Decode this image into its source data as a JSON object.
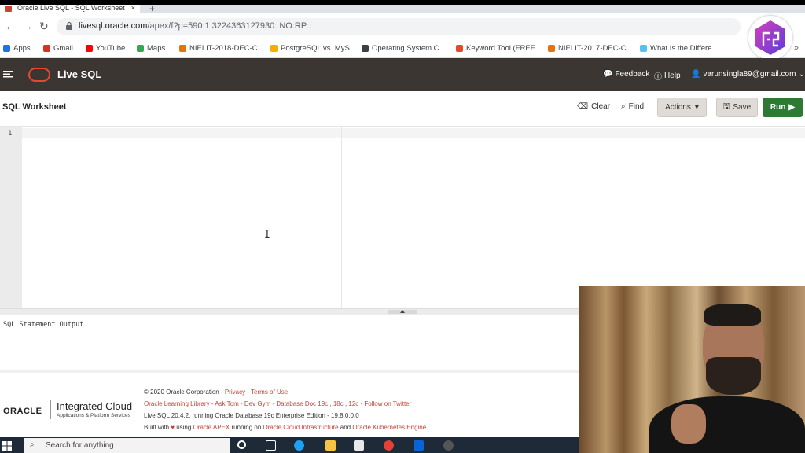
{
  "browser": {
    "tab_title": "Oracle Live SQL - SQL Worksheet",
    "tab_close": "×",
    "new_tab": "+",
    "url_host": "livesql.oracle.com",
    "url_path": "/apex/f?p=590:1:3224363127930::NO:RP::",
    "bookmarks": [
      {
        "label": "Apps",
        "color": "#1a73e8"
      },
      {
        "label": "Gmail",
        "color": "#d93025"
      },
      {
        "label": "YouTube",
        "color": "#ff0000"
      },
      {
        "label": "Maps",
        "color": "#34a853"
      },
      {
        "label": "NIELIT-2018-DEC-C...",
        "color": "#e8710a"
      },
      {
        "label": "PostgreSQL vs. MyS...",
        "color": "#f9ab00"
      },
      {
        "label": "Operating System C...",
        "color": "#3c4043"
      },
      {
        "label": "Keyword Tool (FREE...",
        "color": "#e8472f"
      },
      {
        "label": "NIELIT-2017-DEC-C...",
        "color": "#e8710a"
      },
      {
        "label": "What Is the Differe...",
        "color": "#4fc3f7"
      }
    ],
    "bookmarks_more": "»"
  },
  "app": {
    "name": "Live SQL",
    "feedback": "Feedback",
    "help": "Help",
    "user": "varunsingla89@gmail.com",
    "brand_color": "#e8472f"
  },
  "worksheet": {
    "title": "SQL Worksheet",
    "clear": "Clear",
    "find": "Find",
    "actions": "Actions",
    "save": "Save",
    "run": "Run",
    "line_number": "1",
    "cursor": "I"
  },
  "output": {
    "label": "SQL Statement Output"
  },
  "footer": {
    "oracle": "ORACLE",
    "ic_title": "Integrated Cloud",
    "ic_sub": "Applications & Platform Services",
    "line1_a": "© 2020 Oracle Corporation - ",
    "line1_privacy": "Privacy",
    "line1_sep": " - ",
    "line1_terms": "Terms of Use",
    "line2": "Oracle Learning Library - Ask Tom - Dev Gym - Database Doc 19c , 18c , 12c - Follow on Twitter",
    "line3": "Live SQL 20.4.2, running Oracle Database 19c Enterprise Edition - 19.8.0.0.0",
    "line4_a": "Built with ",
    "line4_b": " using ",
    "line4_apex": "Oracle APEX",
    "line4_c": " running on ",
    "line4_oci": "Oracle Cloud Infrastructure",
    "line4_d": " and ",
    "line4_oke": "Oracle Kubernetes Engine"
  },
  "taskbar": {
    "search_placeholder": "Search for anything"
  }
}
